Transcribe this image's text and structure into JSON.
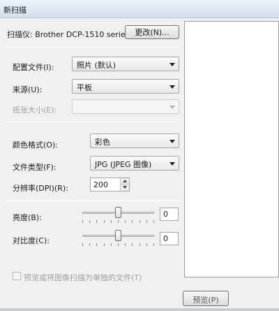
{
  "window": {
    "title": "新扫描"
  },
  "scanner": {
    "label": "扫描仪: Brother DCP-1510 series",
    "change_button": "更改(N)..."
  },
  "profile": {
    "label": "配置文件(I):",
    "value": "照片 (默认)"
  },
  "source": {
    "label": "来源(U):",
    "value": "平板"
  },
  "paper_size": {
    "label": "纸张大小(E):",
    "value": ""
  },
  "color_format": {
    "label": "颜色格式(O):",
    "value": "彩色"
  },
  "file_type": {
    "label": "文件类型(F):",
    "value": "JPG (JPEG 图像)"
  },
  "resolution": {
    "label": "分辨率(DPI)(R):",
    "value": "200"
  },
  "brightness": {
    "label": "亮度(B):",
    "value": "0",
    "level": 0
  },
  "contrast": {
    "label": "对比度(C):",
    "value": "0",
    "level": 0
  },
  "preview_option": {
    "label": "预览或将图像扫描为单独的文件(T)",
    "checked": false
  },
  "preview_button": {
    "label": "预览(P)"
  },
  "colors": {
    "accent": "#d9534f",
    "window_bg": "#f0f0f0"
  }
}
